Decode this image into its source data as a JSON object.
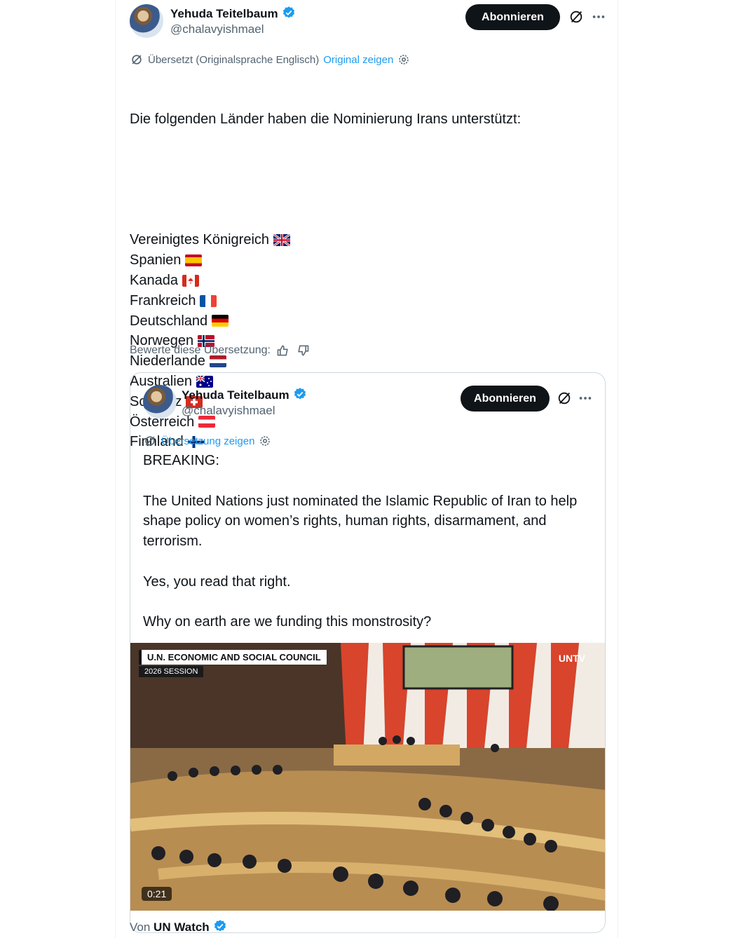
{
  "post": {
    "author_name": "Yehuda Teitelbaum",
    "author_handle": "@chalavyishmael",
    "follow_label": "Abonnieren",
    "translation_note": "Übersetzt (Originalsprache Englisch)",
    "show_original": "Original zeigen",
    "intro": "Die folgenden Länder haben die Nominierung Irans unterstützt:",
    "countries": [
      {
        "name": "Vereinigtes Königreich",
        "flag": "gb-flag"
      },
      {
        "name": "Spanien",
        "flag": "es-flag"
      },
      {
        "name": "Kanada",
        "flag": "ca-flag"
      },
      {
        "name": "Frankreich",
        "flag": "fr-flag"
      },
      {
        "name": "Deutschland",
        "flag": "de-flag"
      },
      {
        "name": "Norwegen",
        "flag": "no-flag"
      },
      {
        "name": "Niederlande",
        "flag": "nl-flag"
      },
      {
        "name": "Australien",
        "flag": "au-flag"
      },
      {
        "name": "Schweiz",
        "flag": "ch-flag"
      },
      {
        "name": "Österreich",
        "flag": "at-flag"
      },
      {
        "name": "Finnland",
        "flag": "fi-flag"
      }
    ],
    "rate_label": "Bewerte diese Übersetzung:"
  },
  "quote": {
    "author_name": "Yehuda Teitelbaum",
    "author_handle": "@chalavyishmael",
    "follow_label": "Abonnieren",
    "show_translation": "Übersetzung zeigen",
    "text": "BREAKING:\n\nThe United Nations just nominated the Islamic Republic of Iran to help\nshape policy on women’s rights, human rights, disarmament, and\nterrorism.\n\nYes, you read that right.\n\nWhy on earth are we funding this monstrosity?",
    "video": {
      "banner_title": "U.N. ECONOMIC AND SOCIAL COUNCIL",
      "banner_sub": "2026 SESSION",
      "channel": "UNTV",
      "duration": "0:21"
    }
  },
  "source": {
    "prefix": "Von",
    "name": "UN Watch"
  },
  "colors": {
    "accent": "#1d9bf0",
    "text": "#0f1419",
    "muted": "#536471",
    "button": "#0f1419"
  }
}
